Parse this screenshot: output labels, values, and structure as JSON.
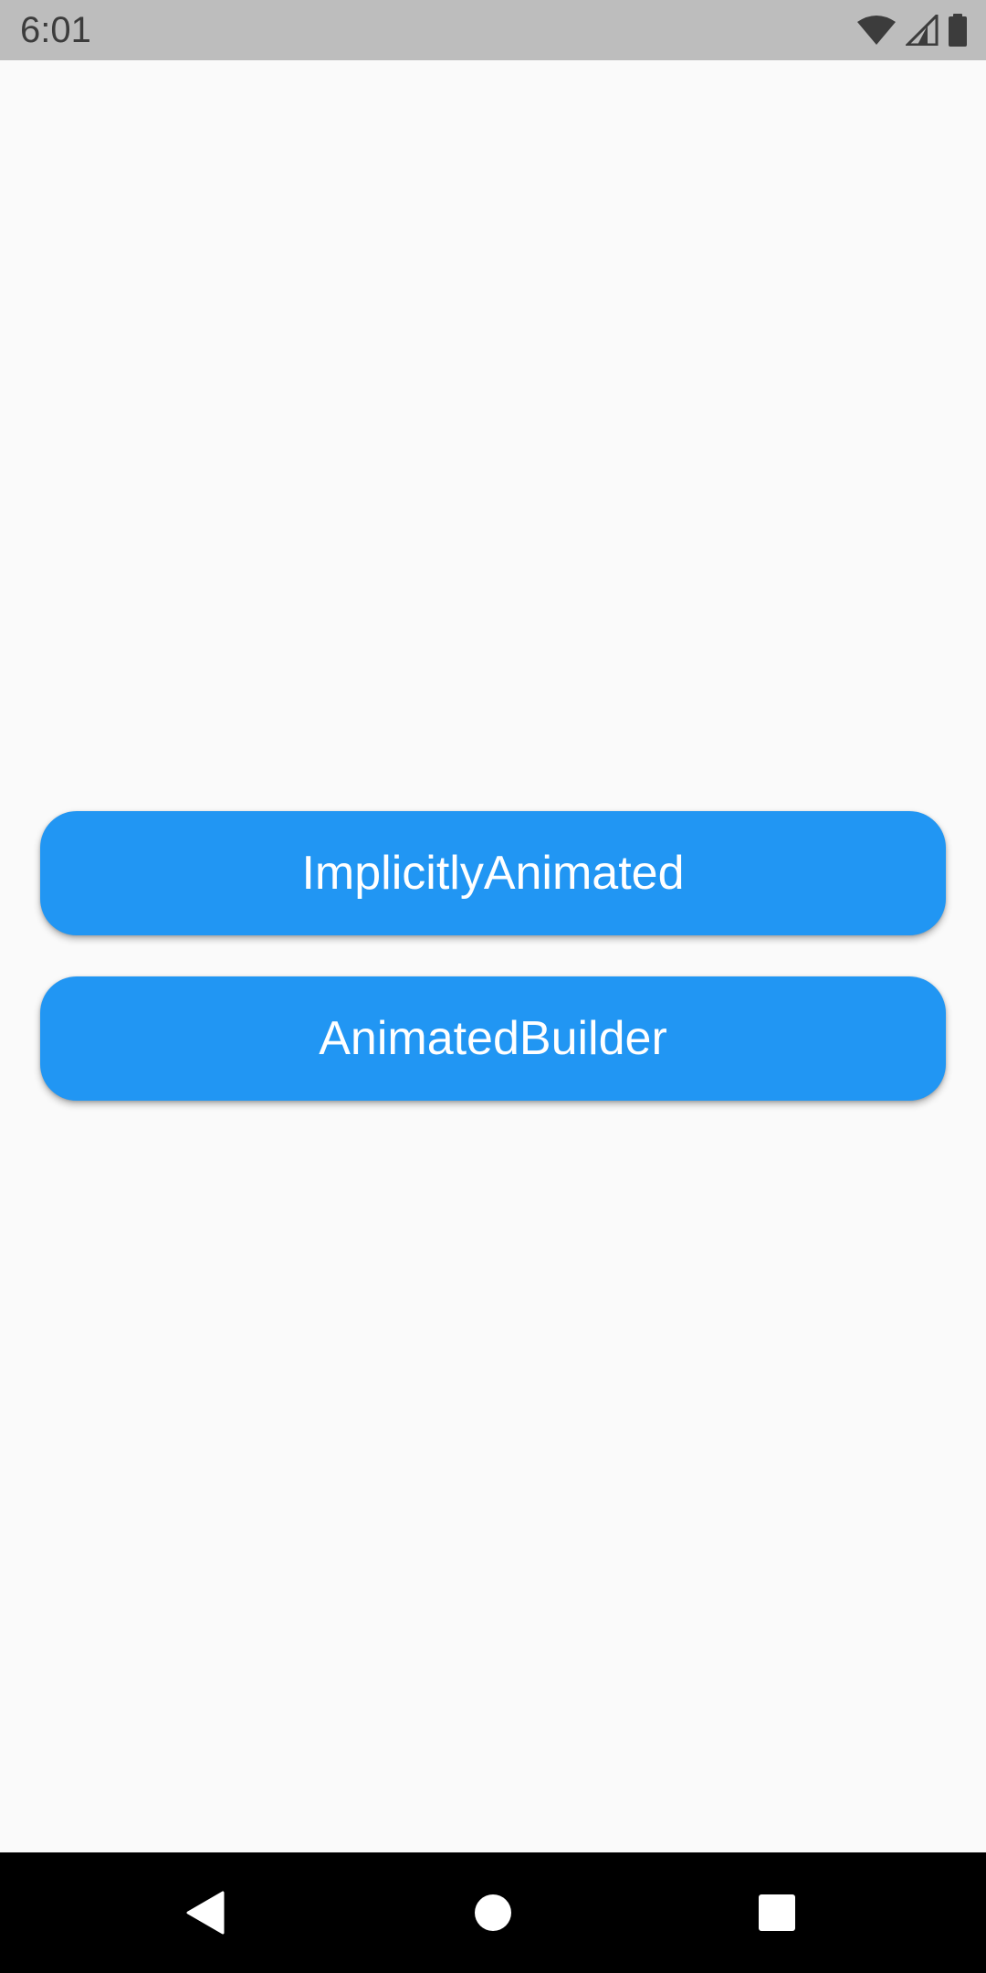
{
  "status_bar": {
    "time": "6:01",
    "icons": [
      "wifi-icon",
      "signal-icon",
      "battery-icon"
    ]
  },
  "buttons": [
    {
      "label": "ImplicitlyAnimated"
    },
    {
      "label": "AnimatedBuilder"
    }
  ],
  "nav_bar": {
    "icons": [
      "back-icon",
      "home-icon",
      "recents-icon"
    ]
  },
  "colors": {
    "button_background": "#2196f3",
    "button_text": "#ffffff",
    "status_bar": "#bdbdbd",
    "page_background": "#fafafa",
    "nav_bar": "#000000"
  }
}
